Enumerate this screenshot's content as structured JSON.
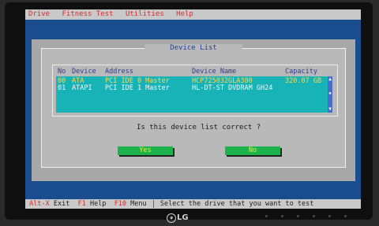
{
  "menu": [
    "Drive",
    "Fitness Test",
    "Utilities",
    "Help"
  ],
  "dialog": {
    "title": "Device List",
    "columns": [
      "No",
      "Device",
      "Address",
      "Device Name",
      "Capacity"
    ],
    "rows": [
      {
        "no": "00",
        "device": "ATA",
        "address": "PCI IDE 0 Master",
        "name": "HCP725032GLA380",
        "capacity": "320.07 GB"
      },
      {
        "no": "01",
        "device": "ATAPI",
        "address": "PCI IDE 1 Master",
        "name": "HL-DT-ST DVDRAM GH24",
        "capacity": ""
      }
    ],
    "question": "Is this device list correct ?",
    "yes_label": "Yes",
    "no_label": "No"
  },
  "status": {
    "alt_key": "Alt-X",
    "alt_label": "Exit",
    "f1_key": "F1",
    "f1_label": "Help",
    "f10_key": "F10",
    "f10_label": "Menu",
    "message": "Select the drive that you want to test"
  },
  "brand": "LG",
  "colors": {
    "screen_bg": "#1a4d8f",
    "dialog_bg": "#b9b9b9",
    "list_bg": "#18b3b6",
    "selected_row": "#ffd84a",
    "button_bg": "#1bb34a"
  }
}
